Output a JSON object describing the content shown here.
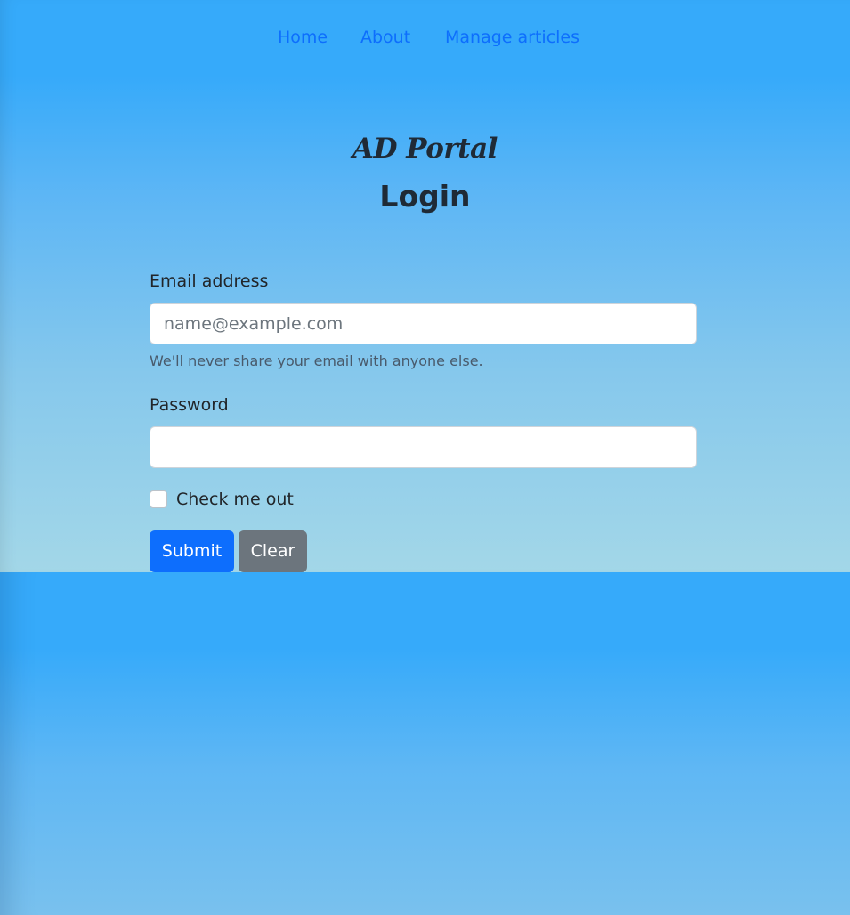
{
  "nav": {
    "items": [
      {
        "label": "Home"
      },
      {
        "label": "About"
      },
      {
        "label": "Manage articles"
      }
    ]
  },
  "header": {
    "brand": "AD Portal",
    "title": "Login"
  },
  "form": {
    "email": {
      "label": "Email address",
      "placeholder": "name@example.com",
      "value": "",
      "help": "We'll never share your email with anyone else."
    },
    "password": {
      "label": "Password",
      "value": ""
    },
    "checkbox": {
      "label": "Check me out",
      "checked": false
    },
    "submit_label": "Submit",
    "clear_label": "Clear"
  },
  "colors": {
    "background_top": "#36aafa",
    "background_bottom": "#a3d7e8",
    "link": "#0d6efd",
    "primary": "#0d6efd",
    "secondary": "#6c757d"
  }
}
